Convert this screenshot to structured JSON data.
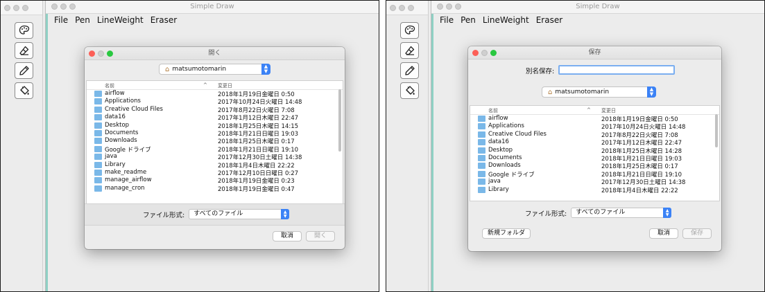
{
  "app": {
    "title": "Simple Draw",
    "menu": [
      "File",
      "Pen",
      "LineWeight",
      "Eraser"
    ],
    "tools": [
      {
        "icon": "palette-icon"
      },
      {
        "icon": "eraser-icon"
      },
      {
        "icon": "pencil-icon"
      },
      {
        "icon": "paint-bucket-icon"
      }
    ]
  },
  "open_dialog": {
    "title": "開く",
    "location": "matsumotomarin",
    "column_name": "名前",
    "column_date": "変更日",
    "sort_indicator": "^",
    "files": [
      {
        "name": "airflow",
        "date": "2018年1月19日金曜日 0:50"
      },
      {
        "name": "Applications",
        "date": "2017年10月24日火曜日 14:48"
      },
      {
        "name": "Creative Cloud Files",
        "date": "2017年8月22日火曜日 7:08"
      },
      {
        "name": "data16",
        "date": "2017年1月12日木曜日 22:47"
      },
      {
        "name": "Desktop",
        "date": "2018年1月25日木曜日 14:15"
      },
      {
        "name": "Documents",
        "date": "2018年1月21日日曜日 19:03"
      },
      {
        "name": "Downloads",
        "date": "2018年1月25日木曜日 0:17"
      },
      {
        "name": "Google ドライブ",
        "date": "2018年1月21日日曜日 19:10"
      },
      {
        "name": "java",
        "date": "2017年12月30日土曜日 14:38"
      },
      {
        "name": "Library",
        "date": "2018年1月4日木曜日 22:22"
      },
      {
        "name": "make_readme",
        "date": "2017年12月10日日曜日 0:27"
      },
      {
        "name": "manage_airflow",
        "date": "2018年1月19日金曜日 0:23"
      },
      {
        "name": "manage_cron",
        "date": "2018年1月19日金曜日 0:47"
      }
    ],
    "format_label": "ファイル形式:",
    "format_value": "すべてのファイル",
    "cancel_label": "取消",
    "open_label": "開く"
  },
  "save_dialog": {
    "title": "保存",
    "save_as_label": "別名保存:",
    "save_as_value": "",
    "location": "matsumotomarin",
    "column_name": "名前",
    "column_date": "変更日",
    "sort_indicator": "^",
    "files": [
      {
        "name": "airflow",
        "date": "2018年1月19日金曜日 0:50"
      },
      {
        "name": "Applications",
        "date": "2017年10月24日火曜日 14:48"
      },
      {
        "name": "Creative Cloud Files",
        "date": "2017年8月22日火曜日 7:08"
      },
      {
        "name": "data16",
        "date": "2017年1月12日木曜日 22:47"
      },
      {
        "name": "Desktop",
        "date": "2018年1月25日木曜日 14:28"
      },
      {
        "name": "Documents",
        "date": "2018年1月21日日曜日 19:03"
      },
      {
        "name": "Downloads",
        "date": "2018年1月25日木曜日 0:17"
      },
      {
        "name": "Google ドライブ",
        "date": "2018年1月21日日曜日 19:10"
      },
      {
        "name": "java",
        "date": "2017年12月30日土曜日 14:38"
      },
      {
        "name": "Library",
        "date": "2018年1月4日木曜日 22:22"
      }
    ],
    "format_label": "ファイル形式:",
    "format_value": "すべてのファイル",
    "new_folder_label": "新規フォルダ",
    "cancel_label": "取消",
    "save_label": "保存"
  }
}
